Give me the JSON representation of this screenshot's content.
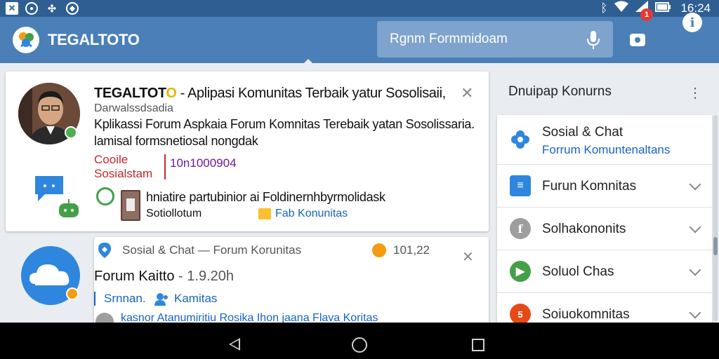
{
  "status_bar": {
    "time": "16:24",
    "left_icons": [
      "x-box-icon",
      "circle-icon",
      "pinwheel-icon",
      "compass-icon"
    ],
    "right_icons": [
      "bluetooth-icon",
      "wifi-icon",
      "signal-icon",
      "battery-icon"
    ]
  },
  "app_bar": {
    "title": "TEGALTOTO",
    "search_placeholder": "Rgnm Formmidoam",
    "notification_count": "1"
  },
  "main_card": {
    "title_brand": "TEGALTOT",
    "title_o": "O",
    "title_rest": " - Aplipasi Komunitas Terbaik yatur Sosolisaii,",
    "subtitle": "Darwalssdsadia",
    "desc_line1": "Kplikassi Forum Aspkaia Forum Komnitas Terebaik yatan Sosolissaria.",
    "desc_line2": "lamisal formsnetiosal nongdak",
    "tag_red_line1": "Cooile",
    "tag_red_line2": "Sosialstam",
    "tag_purple": "10n1000904",
    "row_text": "hniatire partubinior ai Foldinernhbyrmolidask",
    "row_small": "Sotiollotum",
    "row_link": "Fab Konunitas"
  },
  "second_card": {
    "header": "Sosial & Chat  —  Forum Korunitas",
    "time": "101,22",
    "title": "Forum Kaitto",
    "title_time": "- 1.9.20h",
    "tag1": "Srnnan.",
    "tag2": "Kamitas",
    "footer": "kasnor Atanumiritiu Rosika Ihon jaana Flava Koritas"
  },
  "right_panel": {
    "title": "Dnuipap Konurns",
    "items": [
      {
        "label": "Sosial & Chat",
        "sub": "Forrum Komuntenaltans",
        "icon": "flower-icon",
        "color": "#2e86de"
      },
      {
        "label": "Furun Komnitas",
        "icon": "list-icon",
        "color": "#2e86de"
      },
      {
        "label": "Solhakononits",
        "icon": "letter-f-icon",
        "color": "#9e9e9e"
      },
      {
        "label": "Soluol Chas",
        "icon": "play-icon",
        "color": "#43a047"
      },
      {
        "label": "Soiuokomnitas",
        "icon": "html-icon",
        "color": "#e64a19"
      }
    ]
  }
}
